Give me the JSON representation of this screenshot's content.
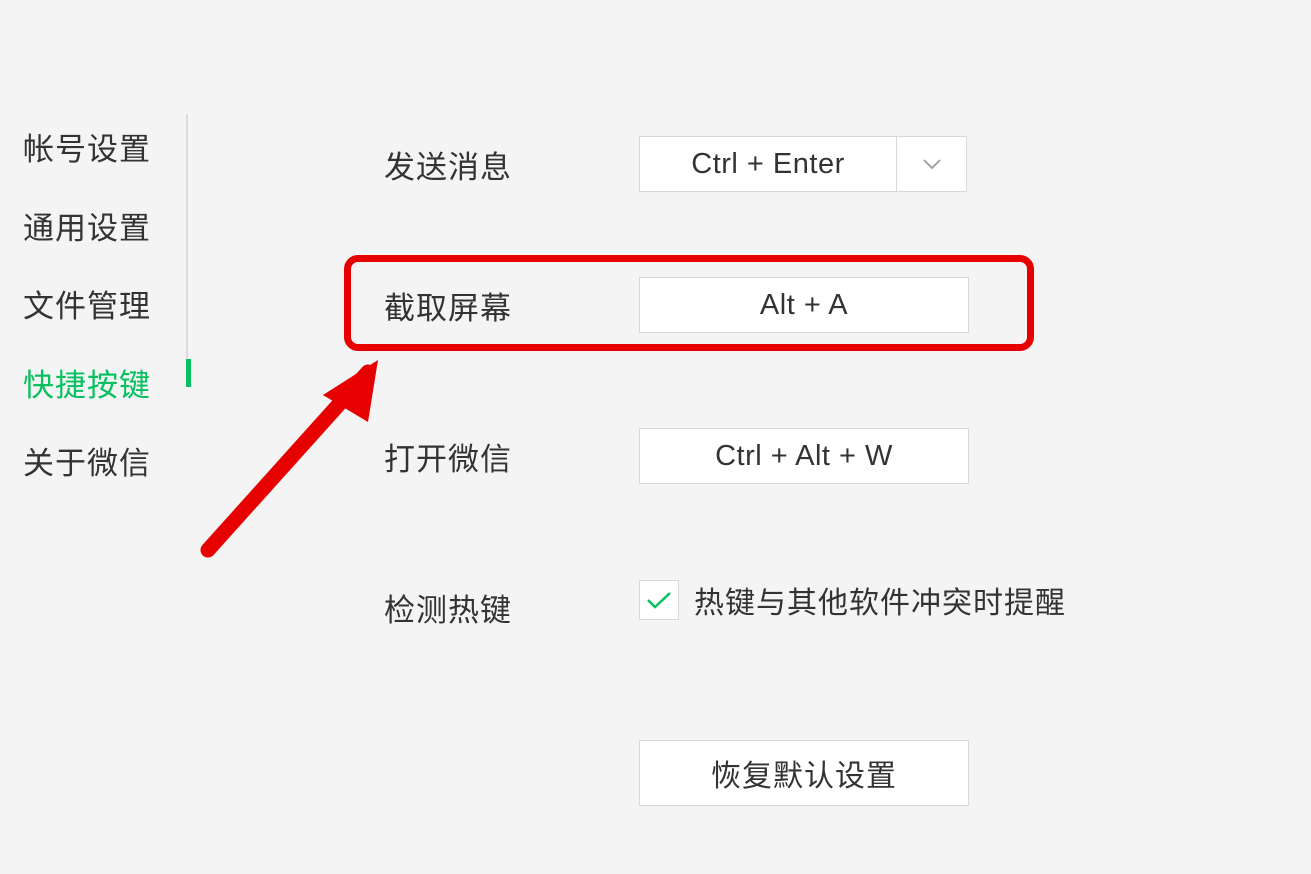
{
  "sidebar": {
    "items": [
      {
        "label": "帐号设置"
      },
      {
        "label": "通用设置"
      },
      {
        "label": "文件管理"
      },
      {
        "label": "快捷按键"
      },
      {
        "label": "关于微信"
      }
    ]
  },
  "content": {
    "sendMessage": {
      "label": "发送消息",
      "value": "Ctrl + Enter"
    },
    "screenshot": {
      "label": "截取屏幕",
      "value": "Alt + A"
    },
    "openApp": {
      "label": "打开微信",
      "value": "Ctrl + Alt + W"
    },
    "detectHotkey": {
      "label": "检测热键",
      "checkboxLabel": "热键与其他软件冲突时提醒"
    },
    "restoreButton": "恢复默认设置"
  }
}
